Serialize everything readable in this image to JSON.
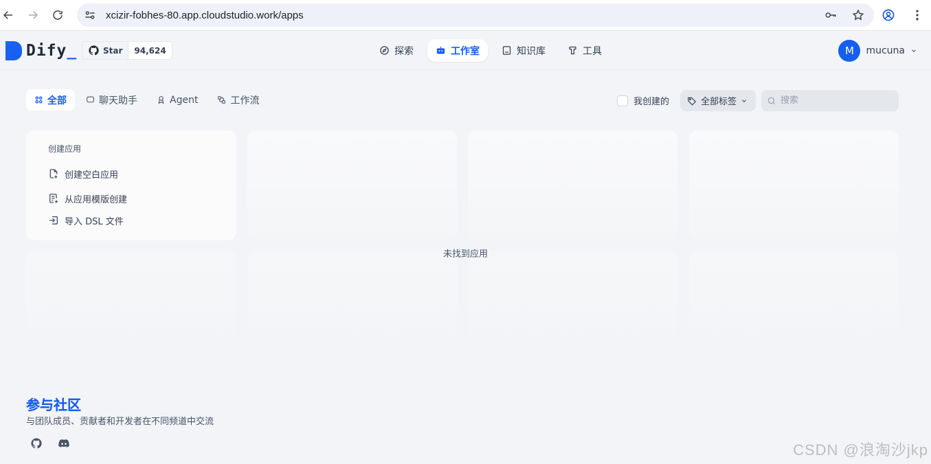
{
  "browser": {
    "url": "xcizir-fobhes-80.app.cloudstudio.work/apps"
  },
  "header": {
    "logo_text": "Dify",
    "github": {
      "star_label": "Star",
      "star_count": "94,624"
    },
    "nav": [
      {
        "label": "探索",
        "icon": "compass-icon"
      },
      {
        "label": "工作室",
        "icon": "robot-icon",
        "active": true
      },
      {
        "label": "知识库",
        "icon": "book-icon"
      },
      {
        "label": "工具",
        "icon": "tool-icon"
      }
    ],
    "user": {
      "avatar_letter": "M",
      "name": "mucuna"
    }
  },
  "filters": {
    "tabs": [
      {
        "label": "全部",
        "icon": "grid-icon",
        "active": true
      },
      {
        "label": "聊天助手",
        "icon": "chat-icon"
      },
      {
        "label": "Agent",
        "icon": "agent-icon"
      },
      {
        "label": "工作流",
        "icon": "workflow-icon"
      }
    ],
    "my_created_label": "我创建的",
    "tag_filter_label": "全部标签",
    "search_placeholder": "搜索"
  },
  "create_card": {
    "title": "创建应用",
    "items": [
      {
        "label": "创建空白应用",
        "icon": "blank-file-icon"
      },
      {
        "label": "从应用模版创建",
        "icon": "template-icon"
      },
      {
        "label": "导入 DSL 文件",
        "icon": "import-icon"
      }
    ]
  },
  "empty_message": "未找到应用",
  "community": {
    "title": "参与社区",
    "subtitle": "与团队成员、贡献者和开发者在不同频道中交流"
  },
  "watermark": "CSDN @浪淘沙jkp",
  "colors": {
    "accent": "#155eef",
    "background": "#f2f4f7"
  }
}
